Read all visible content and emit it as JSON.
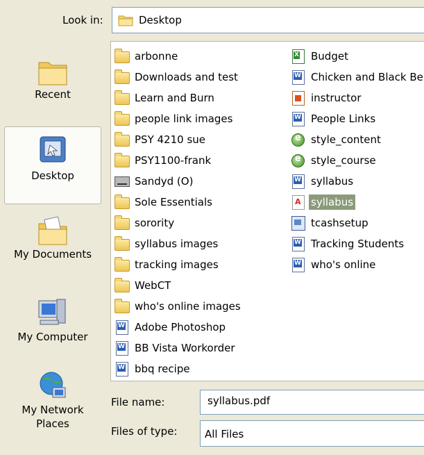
{
  "look_in": {
    "label": "Look in:",
    "value": "Desktop"
  },
  "places": [
    {
      "label": "Recent",
      "icon": "recent-folder-icon"
    },
    {
      "label": "Desktop",
      "icon": "desktop-icon",
      "selected": true
    },
    {
      "label": "My Documents",
      "icon": "my-documents-icon"
    },
    {
      "label": "My Computer",
      "icon": "my-computer-icon"
    },
    {
      "label": "My Network Places",
      "icon": "network-icon"
    }
  ],
  "files_col1": [
    {
      "name": "arbonne",
      "icon": "folder-icon"
    },
    {
      "name": "Downloads and test",
      "icon": "folder-icon"
    },
    {
      "name": "Learn and Burn",
      "icon": "folder-icon"
    },
    {
      "name": "people link images",
      "icon": "folder-icon"
    },
    {
      "name": "PSY 4210 sue",
      "icon": "folder-icon"
    },
    {
      "name": "PSY1100-frank",
      "icon": "folder-icon"
    },
    {
      "name": "Sandyd (O)",
      "icon": "network-drive-icon"
    },
    {
      "name": "Sole Essentials",
      "icon": "folder-icon"
    },
    {
      "name": "sorority",
      "icon": "folder-icon"
    },
    {
      "name": "syllabus images",
      "icon": "folder-icon"
    },
    {
      "name": "tracking images",
      "icon": "folder-icon"
    },
    {
      "name": "WebCT",
      "icon": "folder-icon"
    },
    {
      "name": "who's online images",
      "icon": "folder-icon"
    },
    {
      "name": "Adobe Photoshop",
      "icon": "word-doc-icon"
    },
    {
      "name": "BB Vista Workorder",
      "icon": "word-doc-icon"
    },
    {
      "name": "bbq recipe",
      "icon": "word-doc-icon"
    }
  ],
  "files_col2": [
    {
      "name": "Budget",
      "icon": "excel-icon"
    },
    {
      "name": "Chicken and Black Be",
      "icon": "word-doc-icon"
    },
    {
      "name": "instructor",
      "icon": "powerpoint-icon"
    },
    {
      "name": "People Links",
      "icon": "word-doc-icon"
    },
    {
      "name": "style_content",
      "icon": "web-page-icon"
    },
    {
      "name": "style_course",
      "icon": "web-page-icon"
    },
    {
      "name": "syllabus",
      "icon": "word-doc-icon"
    },
    {
      "name": "syllabus",
      "icon": "pdf-icon",
      "selected": true
    },
    {
      "name": "tcashsetup",
      "icon": "setup-icon"
    },
    {
      "name": "Tracking Students",
      "icon": "word-doc-icon"
    },
    {
      "name": "who's online",
      "icon": "word-doc-icon"
    }
  ],
  "file_name": {
    "label": "File name:",
    "value": "syllabus.pdf"
  },
  "file_type": {
    "label": "Files of type:",
    "value": "All Files"
  },
  "colors": {
    "selection": "#8b9b7a",
    "dialog_bg": "#ece9d8",
    "border": "#7f9db9"
  }
}
